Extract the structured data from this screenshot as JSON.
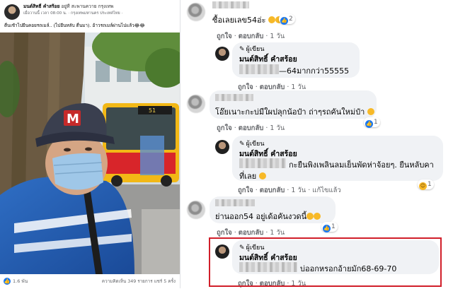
{
  "post": {
    "author": "มนต์สิทธิ์ คำสร้อย",
    "location_text": "อยู่ที่ สะพานควาย กรุงเทพ",
    "meta": "เมื่อวานนี้ เวลา 08:00 น. · กรุงเทพมหานคร ประเทศไทย ·",
    "caption": "ตื่นเช้าไปยืนคอยรถเมล์.. (ไปยืนหลับ ตื่นมา). อ้าวรถเมล์ผ่านไปแล้ว😂😂",
    "bus_number": "51",
    "reactions_count": "1.6 พัน",
    "stats": "ความคิดเห็น 349 รายการ  แชร์ 5 ครั้ง",
    "cap_letter": "M"
  },
  "comments": [
    {
      "text": "ซื้อเลยเลข54อ่ะ",
      "reaction_count": "2",
      "actions": {
        "like": "ถูกใจ",
        "reply": "ตอบกลับ",
        "time": "1 วัน"
      }
    },
    {
      "author_tag": "ผู้เขียน",
      "name": "มนต์สิทธิ์ คำสร้อย",
      "text": "—64มากกว่า55555",
      "actions": {
        "like": "ถูกใจ",
        "reply": "ตอบกลับ",
        "time": "1 วัน"
      }
    },
    {
      "text": "โอ๊ยเนาะกะบ่มีใผปลุกน้อป๋า ถ่าๆรถคันใหม่ป๋า",
      "reaction_count": "1",
      "actions": {
        "like": "ถูกใจ",
        "reply": "ตอบกลับ",
        "time": "1 วัน"
      }
    },
    {
      "author_tag": "ผู้เขียน",
      "name": "มนต์สิทธิ์ คำสร้อย",
      "text_line1": "กะยืนพิงเพลินลมเย็นพัดห่าจ้อยๆ. ยืนหลับคา",
      "text_line2": "ที่เลย",
      "reaction_count": "1",
      "actions": {
        "like": "ถูกใจ",
        "reply": "ตอบกลับ",
        "time": "1 วัน",
        "edited": "แก้ไขแล้ว"
      }
    },
    {
      "text": "ย่านออก54 อยู่เด้อคันงวดนี้",
      "reaction_count": "1",
      "actions": {
        "like": "ถูกใจ",
        "reply": "ตอบกลับ",
        "time": "1 วัน"
      }
    },
    {
      "author_tag": "ผู้เขียน",
      "name": "มนต์สิทธิ์ คำสร้อย",
      "text": "บ่ออกหรอกอ้ายมัก68-69-70",
      "actions": {
        "like": "ถูกใจ",
        "reply": "ตอบกลับ",
        "time": "1 วัน"
      }
    }
  ],
  "colors": {
    "link": "#65676b",
    "bubble": "#f0f2f5",
    "highlight": "#d11f2a",
    "like": "#1877f2"
  }
}
